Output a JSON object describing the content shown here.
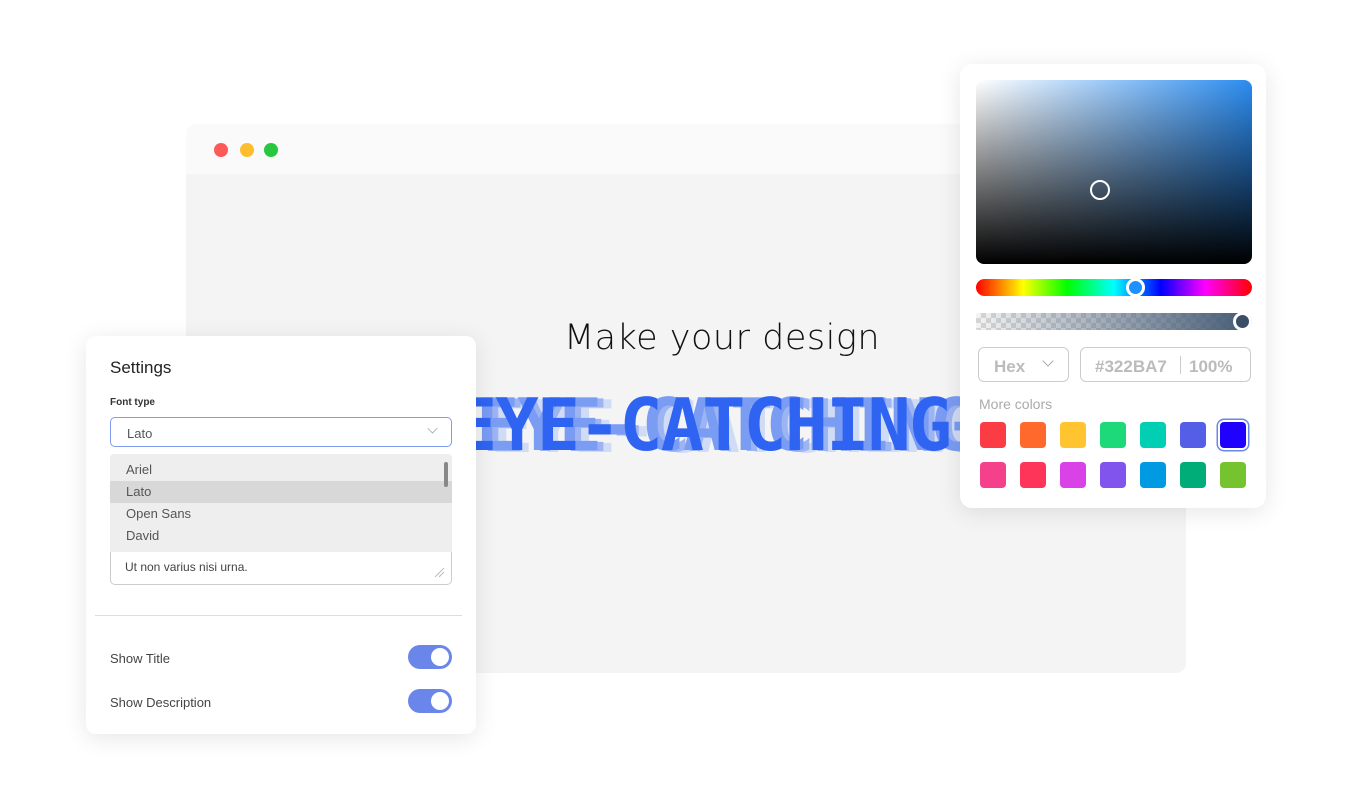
{
  "browser": {
    "traffic_lights": [
      {
        "name": "close",
        "color": "#fc5b57"
      },
      {
        "name": "minimize",
        "color": "#fdbd2e"
      },
      {
        "name": "maximize",
        "color": "#27c840"
      }
    ],
    "headline": "Make your design",
    "highlight": "EYE-CATCHING",
    "highlight_color": "#2f64f2"
  },
  "settings": {
    "title": "Settings",
    "font_label": "Font type",
    "font_selected": "Lato",
    "font_options": [
      "Ariel",
      "Lato",
      "Open Sans",
      "David"
    ],
    "description_text": "Ut non varius nisi urna.",
    "toggles": [
      {
        "label": "Show Title",
        "on": true
      },
      {
        "label": "Show Description",
        "on": true
      }
    ],
    "toggle_color": "#6a86ea"
  },
  "color_picker": {
    "format": "Hex",
    "hex_value": "#322BA7",
    "opacity": "100%",
    "more_colors_label": "More colors",
    "swatches": [
      "#fc3c44",
      "#ff6a2c",
      "#ffc42f",
      "#1ed97a",
      "#00cfb4",
      "#545ee6",
      "#2000ff",
      "#f5408c",
      "#fe3558",
      "#d842e7",
      "#8054ed",
      "#009ae3",
      "#00ad78",
      "#75c42f"
    ],
    "selected_swatch": 6
  }
}
